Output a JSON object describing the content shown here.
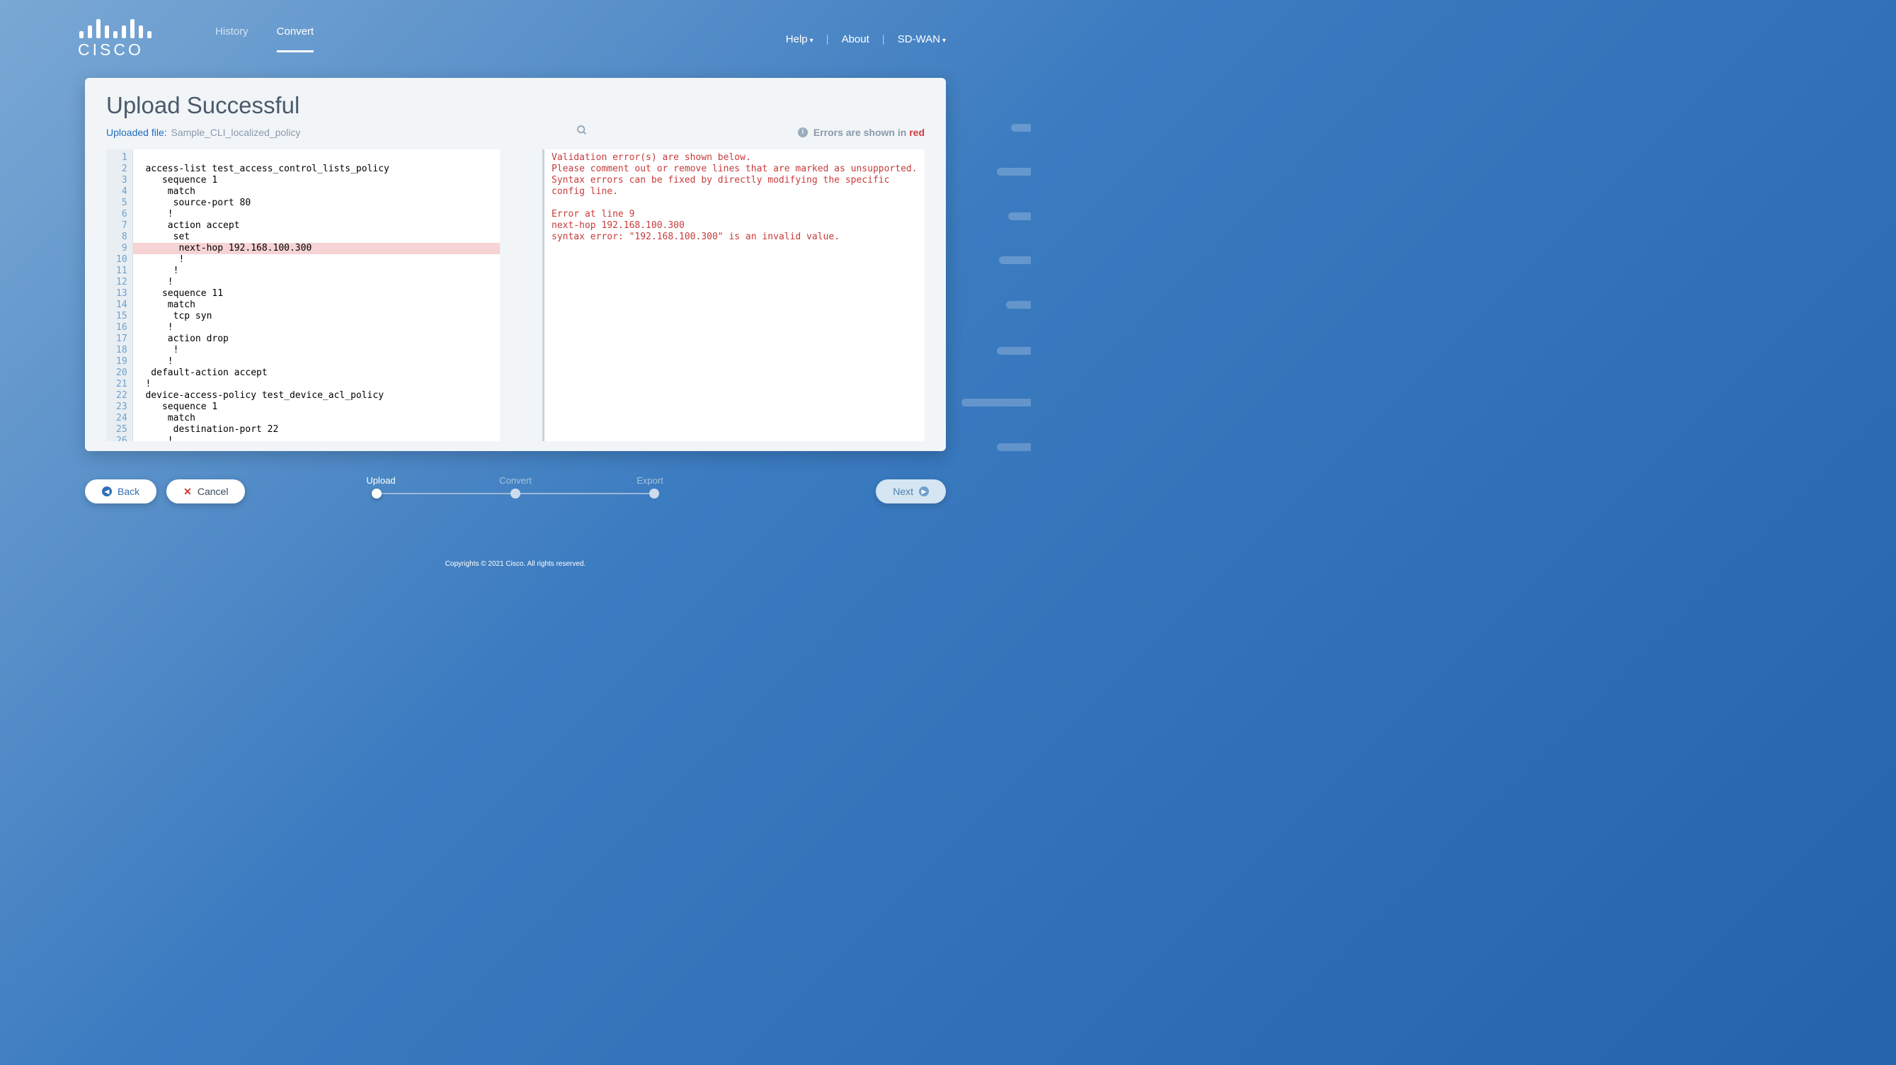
{
  "nav": {
    "history": "History",
    "convert": "Convert"
  },
  "header_right": {
    "help": "Help",
    "about": "About",
    "sdwan": "SD-WAN"
  },
  "page": {
    "title": "Upload Successful",
    "uploaded_label": "Uploaded file:",
    "uploaded_file": "Sample_CLI_localized_policy",
    "errors_prefix": "Errors are shown in",
    "errors_red": "red"
  },
  "code_lines": [
    "",
    " access-list test_access_control_lists_policy",
    "    sequence 1",
    "     match",
    "      source-port 80",
    "     !",
    "     action accept",
    "      set",
    "       next-hop 192.168.100.300",
    "       !",
    "      !",
    "     !",
    "    sequence 11",
    "     match",
    "      tcp syn",
    "     !",
    "     action drop",
    "      !",
    "     !",
    "  default-action accept",
    " !",
    " device-access-policy test_device_acl_policy",
    "    sequence 1",
    "     match",
    "      destination-port 22",
    "     !"
  ],
  "error_line_index": 9,
  "validation": {
    "header1": "Validation error(s) are shown below.",
    "header2": "Please comment out or remove lines that are marked as unsupported. Syntax errors can be fixed by directly modifying the specific config line.",
    "err_at": "Error at line 9",
    "err_val": "next-hop 192.168.100.300",
    "err_msg": "syntax error: \"192.168.100.300\" is an invalid value."
  },
  "buttons": {
    "back": "Back",
    "cancel": "Cancel",
    "next": "Next"
  },
  "stepper": {
    "upload": "Upload",
    "convert": "Convert",
    "export": "Export"
  },
  "copyright": "Copyrights © 2021 Cisco. All rights reserved."
}
